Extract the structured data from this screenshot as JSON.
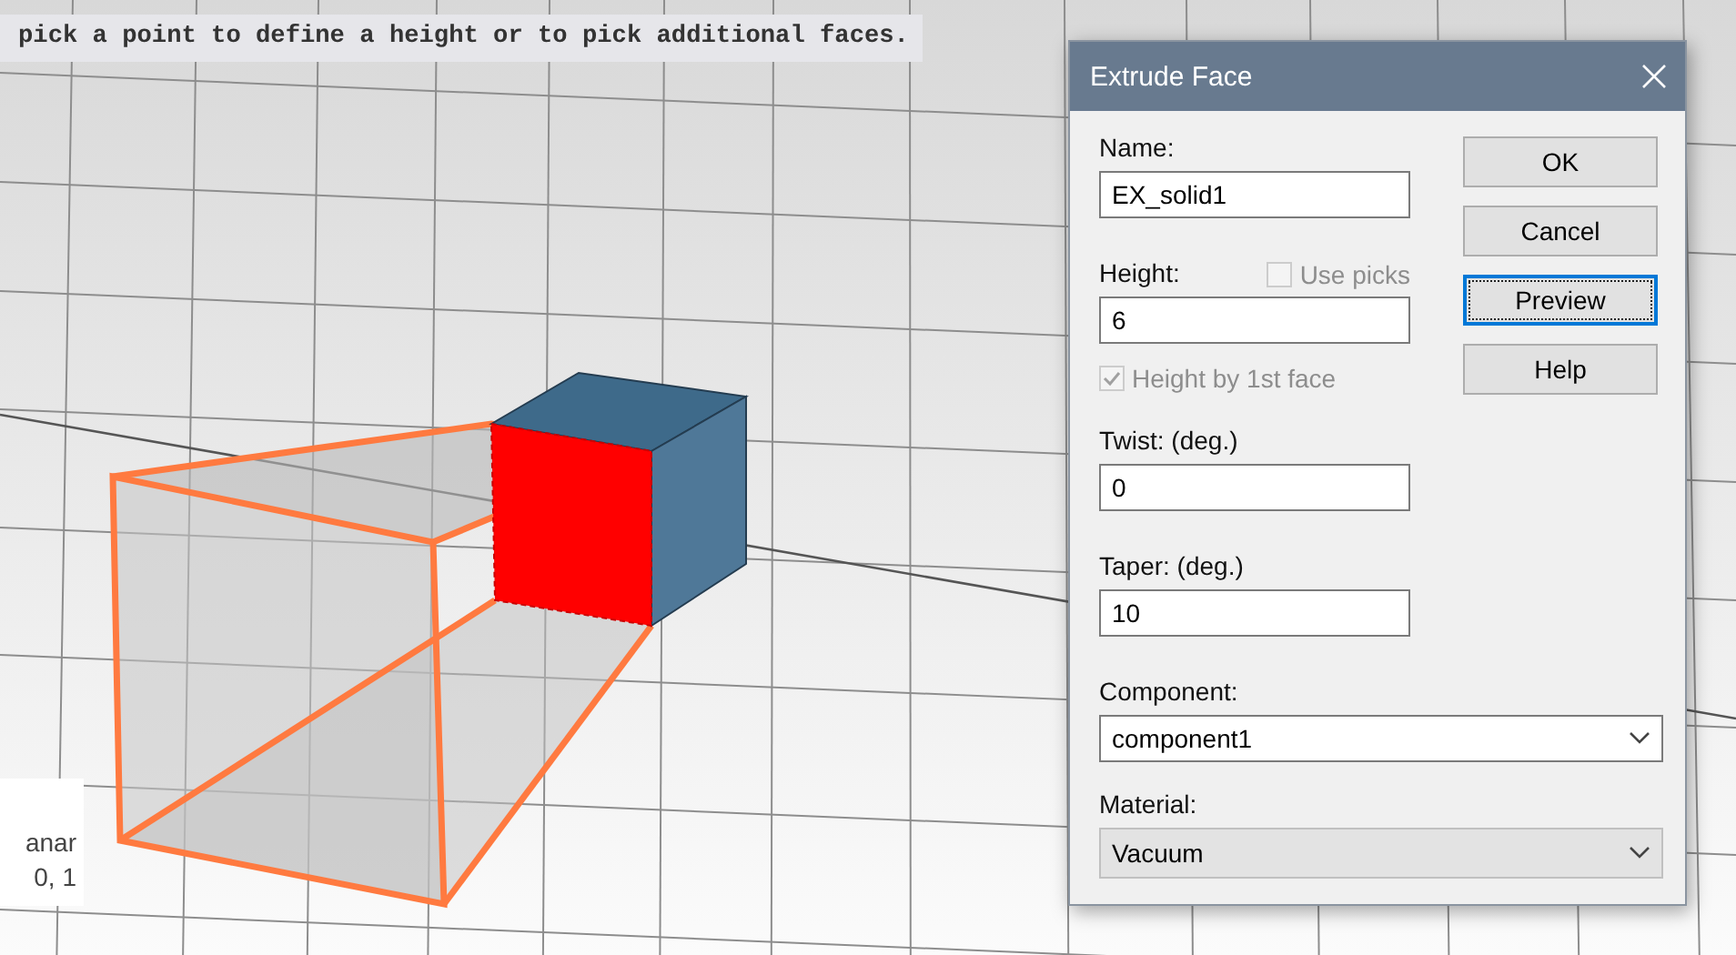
{
  "hint": "pick a point to define a height or to pick additional faces.",
  "info_box": {
    "lines": [
      "anar",
      "0, 1"
    ]
  },
  "dialog": {
    "title": "Extrude Face",
    "fields": [
      {
        "kind": "text",
        "label": "Name:",
        "value": "EX_solid1"
      },
      {
        "kind": "text",
        "label": "Height:",
        "value": "6",
        "option": {
          "label": "Use picks",
          "checked": false,
          "disabled": true
        }
      },
      {
        "kind": "checkbox",
        "label": "Height by 1st face",
        "checked": true,
        "disabled": true
      },
      {
        "kind": "text",
        "label": "Twist: (deg.)",
        "value": "0"
      },
      {
        "kind": "text",
        "label": "Taper: (deg.)",
        "value": "10"
      },
      {
        "kind": "select",
        "label": "Component:",
        "value": "component1",
        "disabled": false
      },
      {
        "kind": "select",
        "label": "Material:",
        "value": "Vacuum",
        "disabled": true
      }
    ],
    "buttons": [
      {
        "label": "OK",
        "focused": false
      },
      {
        "label": "Cancel",
        "focused": false
      },
      {
        "label": "Preview",
        "focused": true
      },
      {
        "label": "Help",
        "focused": false
      }
    ]
  }
}
